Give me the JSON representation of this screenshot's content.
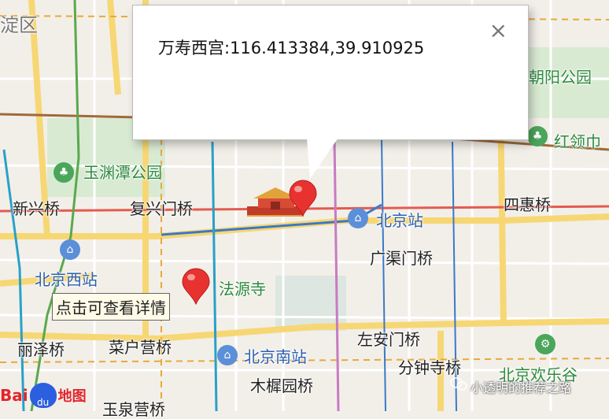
{
  "map": {
    "labels": {
      "haidian_partial": "淀区",
      "yuyuantan": "玉渊潭公园",
      "xinxing_bridge": "新兴桥",
      "fuxingmen_bridge": "复兴门桥",
      "beijing_station": "北京站",
      "sihui_bridge": "四惠桥",
      "guangqumen_bridge": "广渠门桥",
      "beijing_west": "北京西站",
      "fayuan_temple": "法源寺",
      "lize_bridge": "丽泽桥",
      "caihuying_bridge": "菜户营桥",
      "beijing_south": "北京南站",
      "zuoanmen_bridge": "左安门桥",
      "fenzhongsi_bridge": "分钟寺桥",
      "chaoyang_park": "朝阳公园",
      "hongling_partial": "红领巾",
      "huanlegu_partial": "北京欢乐谷",
      "muxiyuan_bridge": "木樨园桥",
      "bottom_partial": "玉泉营桥"
    }
  },
  "infowindow": {
    "text": "万寿西宫:116.413384,39.910925",
    "close_symbol": "×"
  },
  "tooltip": {
    "text": "点击可查看详情"
  },
  "logo": {
    "bai": "Bai",
    "du": "du",
    "map": "地图"
  },
  "watermark": {
    "text": "小透明的推荐之路"
  },
  "colors": {
    "ring_road": "#f7d774",
    "metro_red": "#e55a4f",
    "metro_blue": "#3a79c9",
    "metro_brown": "#a06a3a",
    "metro_purple": "#c77bc2",
    "metro_cyan": "#2aa0c8",
    "metro_green": "#5aa84e",
    "marker": "#e8322f"
  }
}
